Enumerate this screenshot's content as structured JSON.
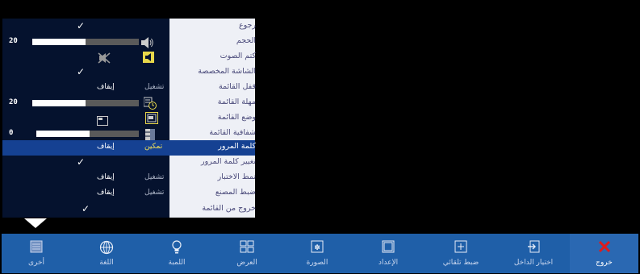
{
  "menu": {
    "rows": [
      {
        "label": "رجوع",
        "value_type": "check"
      },
      {
        "label": "الحجم",
        "value_type": "slider",
        "number": "20",
        "level": 0.5,
        "icon": "speaker-volume-icon"
      },
      {
        "label": "كتم الصوت",
        "value_type": "icons",
        "icons": [
          "muted-speaker-icon",
          "speaker-icon"
        ]
      },
      {
        "label": "الشاشة المخصصة",
        "value_type": "check"
      },
      {
        "label": "قفل القائمة",
        "value_type": "options",
        "options": [
          "تشغيل",
          "إيقاف"
        ],
        "active": 1
      },
      {
        "label": "مهلة القائمة",
        "value_type": "slider",
        "number": "20",
        "level": 0.5,
        "icon": "timer-icon"
      },
      {
        "label": "وضع القائمة",
        "value_type": "icons",
        "icons": [
          "position-small-icon",
          "position-box-icon"
        ]
      },
      {
        "label": "شفافية القائمة",
        "value_type": "slider",
        "number": "0",
        "level": 0.0,
        "icon": "transparency-icon"
      },
      {
        "label": "كلمة المرور",
        "value_type": "options",
        "options": [
          "تمكين",
          "إيقاف"
        ],
        "active": 0,
        "selected": true
      },
      {
        "label": "تغيير كلمة المرور",
        "value_type": "check"
      },
      {
        "label": "نمط الاختبار",
        "value_type": "options",
        "options": [
          "تشغيل",
          "إيقاف"
        ],
        "active": 1
      },
      {
        "label": "ضبط المصنع",
        "value_type": "options",
        "options": [
          "تشغيل",
          "إيقاف"
        ],
        "active": 1
      },
      {
        "label": "خروج من القائمة",
        "value_type": "check"
      }
    ]
  },
  "bottom_bar": {
    "items": [
      {
        "label": "أخرى",
        "icon": "other-list-icon"
      },
      {
        "label": "اللغة",
        "icon": "globe-icon"
      },
      {
        "label": "اللمبة",
        "icon": "lamp-icon"
      },
      {
        "label": "العرض",
        "icon": "display-icon"
      },
      {
        "label": "الصورة",
        "icon": "picture-icon"
      },
      {
        "label": "الإعداد",
        "icon": "setup-icon"
      },
      {
        "label": "ضبط تلقائي",
        "icon": "auto-adjust-icon"
      },
      {
        "label": "اختيار الداخل",
        "icon": "input-select-icon"
      },
      {
        "label": "خروج",
        "icon": "exit-x-icon"
      }
    ]
  },
  "colors": {
    "selected_row": "#154192",
    "bar_bg": "#1f5fa8",
    "exit_x": "#e11b1b",
    "active_option": "#f2e15a"
  }
}
